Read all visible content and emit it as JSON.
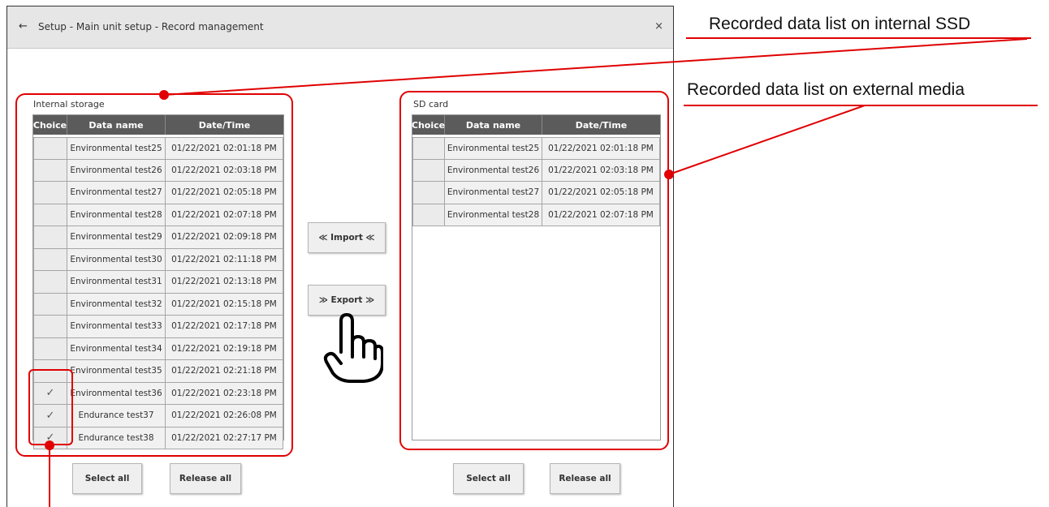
{
  "window": {
    "back_icon": "←",
    "title": "Setup - Main unit setup - Record management",
    "close_icon": "×"
  },
  "internal": {
    "label": "Internal storage",
    "columns": [
      "Choice",
      "Data name",
      "Date/Time"
    ],
    "rows": [
      {
        "checked": false,
        "name": "Environmental test25",
        "datetime": "01/22/2021 02:01:18 PM"
      },
      {
        "checked": false,
        "name": "Environmental test26",
        "datetime": "01/22/2021 02:03:18 PM"
      },
      {
        "checked": false,
        "name": "Environmental test27",
        "datetime": "01/22/2021 02:05:18 PM"
      },
      {
        "checked": false,
        "name": "Environmental test28",
        "datetime": "01/22/2021 02:07:18 PM"
      },
      {
        "checked": false,
        "name": "Environmental test29",
        "datetime": "01/22/2021 02:09:18 PM"
      },
      {
        "checked": false,
        "name": "Environmental test30",
        "datetime": "01/22/2021 02:11:18 PM"
      },
      {
        "checked": false,
        "name": "Environmental test31",
        "datetime": "01/22/2021 02:13:18 PM"
      },
      {
        "checked": false,
        "name": "Environmental test32",
        "datetime": "01/22/2021 02:15:18 PM"
      },
      {
        "checked": false,
        "name": "Environmental test33",
        "datetime": "01/22/2021 02:17:18 PM"
      },
      {
        "checked": false,
        "name": "Environmental test34",
        "datetime": "01/22/2021 02:19:18 PM"
      },
      {
        "checked": false,
        "name": "Environmental test35",
        "datetime": "01/22/2021 02:21:18 PM"
      },
      {
        "checked": true,
        "name": "Environmental test36",
        "datetime": "01/22/2021 02:23:18 PM"
      },
      {
        "checked": true,
        "name": "Endurance test37",
        "datetime": "01/22/2021 02:26:08 PM"
      },
      {
        "checked": true,
        "name": "Endurance test38",
        "datetime": "01/22/2021 02:27:17 PM"
      }
    ],
    "select_all": "Select all",
    "release_all": "Release all"
  },
  "sd": {
    "label": "SD card",
    "columns": [
      "Choice",
      "Data name",
      "Date/Time"
    ],
    "rows": [
      {
        "checked": false,
        "name": "Environmental test25",
        "datetime": "01/22/2021 02:01:18 PM"
      },
      {
        "checked": false,
        "name": "Environmental test26",
        "datetime": "01/22/2021 02:03:18 PM"
      },
      {
        "checked": false,
        "name": "Environmental test27",
        "datetime": "01/22/2021 02:05:18 PM"
      },
      {
        "checked": false,
        "name": "Environmental test28",
        "datetime": "01/22/2021 02:07:18 PM"
      }
    ],
    "select_all": "Select all",
    "release_all": "Release all"
  },
  "actions": {
    "import": "≪ Import ≪",
    "export": "≫ Export ≫"
  },
  "annotations": {
    "internal_ssd": "Recorded data list on internal SSD",
    "external_media": "Recorded data list on external media"
  },
  "check_glyph": "✓",
  "colors": {
    "accent_red": "#e00000",
    "header_bg": "#5b5b5b"
  }
}
